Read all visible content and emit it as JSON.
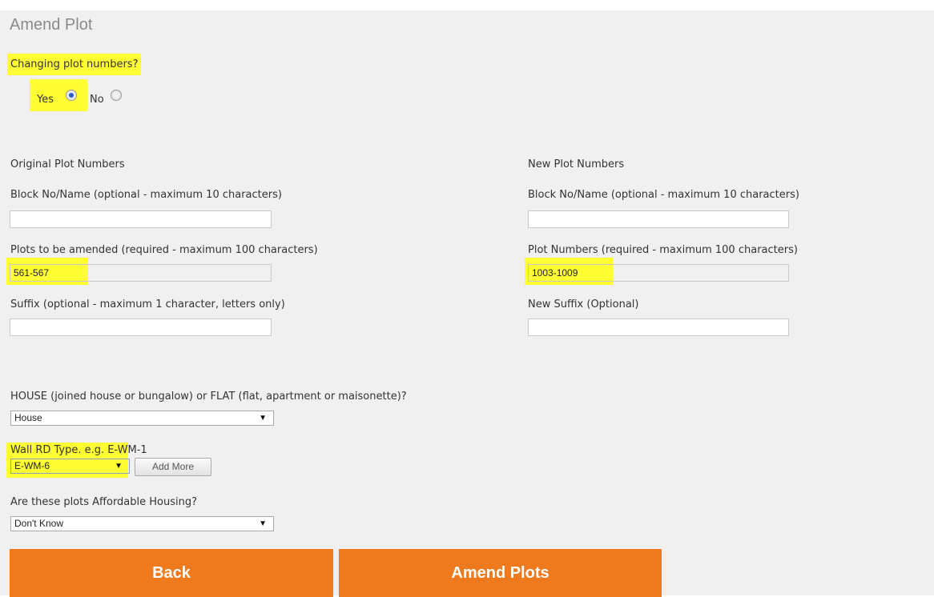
{
  "page": {
    "title": "Amend Plot"
  },
  "changing": {
    "question": "Changing plot numbers?",
    "yes_label": "Yes",
    "no_label": "No",
    "selected": "Yes"
  },
  "original": {
    "heading": "Original Plot Numbers",
    "block_label": "Block No/Name (optional - maximum 10 characters)",
    "block_value": "",
    "plots_label": "Plots to be amended (required - maximum 100 characters)",
    "plots_value": "561-567",
    "suffix_label": "Suffix (optional - maximum 1 character, letters only)",
    "suffix_value": ""
  },
  "new": {
    "heading": "New Plot Numbers",
    "block_label": "Block No/Name (optional - maximum 10 characters)",
    "block_value": "",
    "plots_label": "Plot Numbers (required - maximum 100 characters)",
    "plots_value": "1003-1009",
    "suffix_label": "New Suffix (Optional)",
    "suffix_value": ""
  },
  "house_type": {
    "label": "HOUSE (joined house or bungalow) or FLAT (flat, apartment or maisonette)?",
    "selected": "House"
  },
  "wall": {
    "label": "Wall RD Type. e.g. E-WM-1",
    "selected": "E-WM-6",
    "add_more_label": "Add More"
  },
  "affordable": {
    "label": "Are these plots Affordable Housing?",
    "selected": "Don't Know"
  },
  "actions": {
    "back_label": "Back",
    "amend_label": "Amend Plots",
    "accent_color": "#ef7a1e"
  },
  "highlight_color": "#ffff33"
}
